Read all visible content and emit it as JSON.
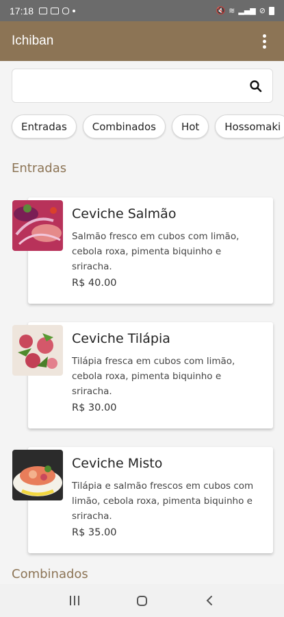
{
  "status_bar": {
    "time": "17:18"
  },
  "app_bar": {
    "title": "Ichiban"
  },
  "search": {
    "placeholder": "",
    "value": ""
  },
  "categories": [
    "Entradas",
    "Combinados",
    "Hot",
    "Hossomaki"
  ],
  "sections": [
    {
      "title": "Entradas",
      "items": [
        {
          "name": "Ceviche Salmão",
          "description": "Salmão fresco em cubos com limão, cebola roxa, pimenta biquinho e sriracha.",
          "price": "R$ 40.00"
        },
        {
          "name": "Ceviche Tilápia",
          "description": "Tilápia fresca em cubos com limão, cebola roxa, pimenta biquinho e sriracha.",
          "price": "R$ 30.00"
        },
        {
          "name": "Ceviche Misto",
          "description": "Tilápia e salmão frescos em cubos com limão, cebola roxa, pimenta biquinho e sriracha.",
          "price": "R$ 35.00"
        }
      ]
    },
    {
      "title": "Combinados",
      "items": []
    }
  ],
  "colors": {
    "accent": "#8c7455",
    "status_bar": "#6b6b6b",
    "background": "#f4f4f4"
  }
}
